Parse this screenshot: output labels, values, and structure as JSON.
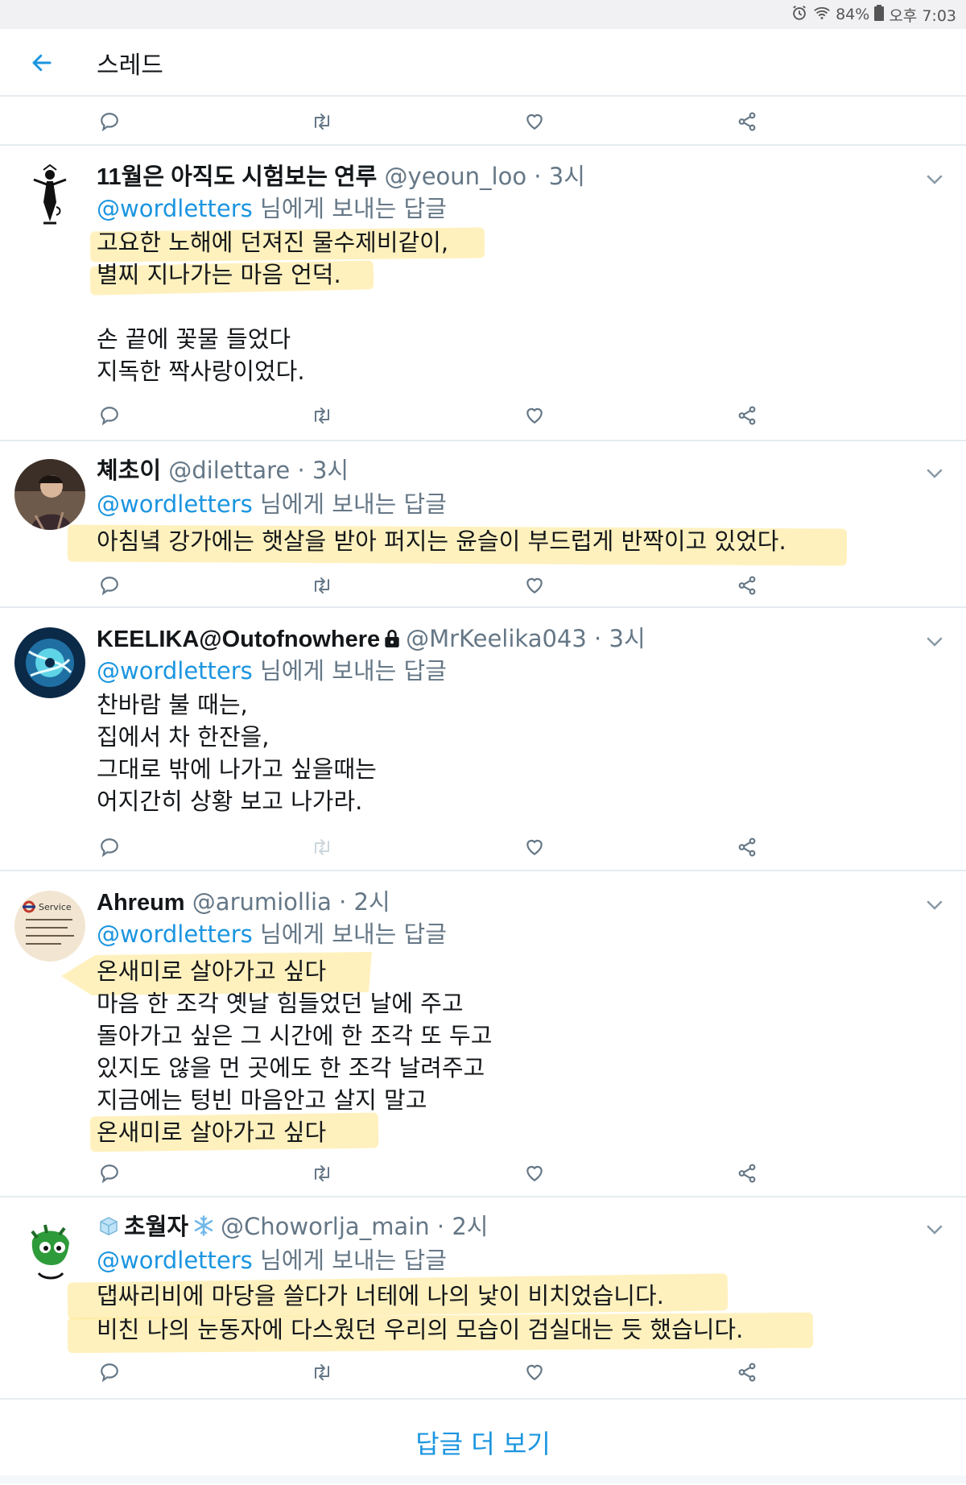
{
  "status": {
    "battery": "84%",
    "time": "오후 7:03"
  },
  "header": {
    "title": "스레드"
  },
  "tweets": [
    {
      "name": "11월은 아직도 시험보는 연루",
      "handle": "@yeoun_loo",
      "time": "3시",
      "mention": "@wordletters",
      "reply_suffix": "님에게 보내는 답글",
      "lines": [
        "고요한 노해에 던져진 물수제비같이,",
        "별찌 지나가는 마음 언덕.",
        "",
        "손 끝에 꽃물 들었다",
        "지독한 짝사랑이었다."
      ]
    },
    {
      "name": "쳬초이",
      "handle": "@dilettare",
      "time": "3시",
      "mention": "@wordletters",
      "reply_suffix": "님에게 보내는 답글",
      "lines": [
        "아침녘 강가에는 햇살을 받아 퍼지는 윤슬이 부드럽게 반짝이고 있었다."
      ]
    },
    {
      "name": "KEELIKA@Outofnowhere",
      "handle": "@MrKeelika043",
      "time": "3시",
      "mention": "@wordletters",
      "reply_suffix": "님에게 보내는 답글",
      "lines": [
        "찬바람 불 때는,",
        "집에서 차 한잔을,",
        "그대로 밖에 나가고 싶을때는",
        "어지간히 상황 보고 나가라."
      ]
    },
    {
      "name": "Ahreum",
      "handle": "@arumiollia",
      "time": "2시",
      "mention": "@wordletters",
      "reply_suffix": "님에게 보내는 답글",
      "lines": [
        "온새미로 살아가고 싶다",
        "마음 한 조각 옛날 힘들었던 날에 주고",
        "돌아가고 싶은 그 시간에 한 조각 또 두고",
        "있지도 않을 먼 곳에도 한 조각 날려주고",
        "지금에는 텅빈 마음안고 살지 말고",
        "온새미로 살아가고 싶다"
      ]
    },
    {
      "name": "초월자",
      "handle": "@Choworlja_main",
      "time": "2시",
      "mention": "@wordletters",
      "reply_suffix": "님에게 보내는 답글",
      "lines": [
        "댑싸리비에 마당을 쓸다가 너테에 나의 낯이 비치었습니다.",
        "비친 나의 눈동자에 다스웠던 우리의 모습이 검실대는 듯 했습니다."
      ]
    }
  ],
  "footer": {
    "more_replies": "답글 더 보기"
  },
  "colors": {
    "accent": "#1b95e0",
    "highlight": "#ffe896",
    "divider": "#e6ecf0"
  }
}
